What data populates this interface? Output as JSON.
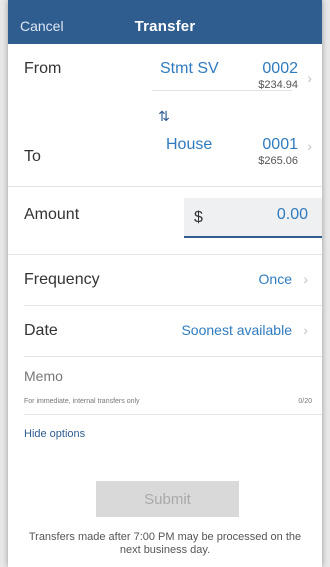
{
  "header": {
    "cancel_label": "Cancel",
    "title": "Transfer"
  },
  "from": {
    "label": "From",
    "account_name": "Stmt SV",
    "account_number": "0002",
    "balance": "$234.94"
  },
  "to": {
    "label": "To",
    "account_name": "House",
    "account_number": "0001",
    "balance": "$265.06"
  },
  "amount": {
    "label": "Amount",
    "currency": "$",
    "value": "0.00"
  },
  "frequency": {
    "label": "Frequency",
    "value": "Once"
  },
  "date": {
    "label": "Date",
    "value": "Soonest available"
  },
  "memo": {
    "label": "Memo",
    "note": "For immediate, internal transfers only",
    "count": "0/20"
  },
  "hide_options_label": "Hide options",
  "submit_label": "Submit",
  "footnote": "Transfers made after 7:00 PM may be processed on the next business day.",
  "icons": {
    "swap": "swap-arrows-icon",
    "chevron": "chevron-right-icon"
  },
  "colors": {
    "header": "#2f5d8f",
    "accent": "#2f7bbf"
  }
}
